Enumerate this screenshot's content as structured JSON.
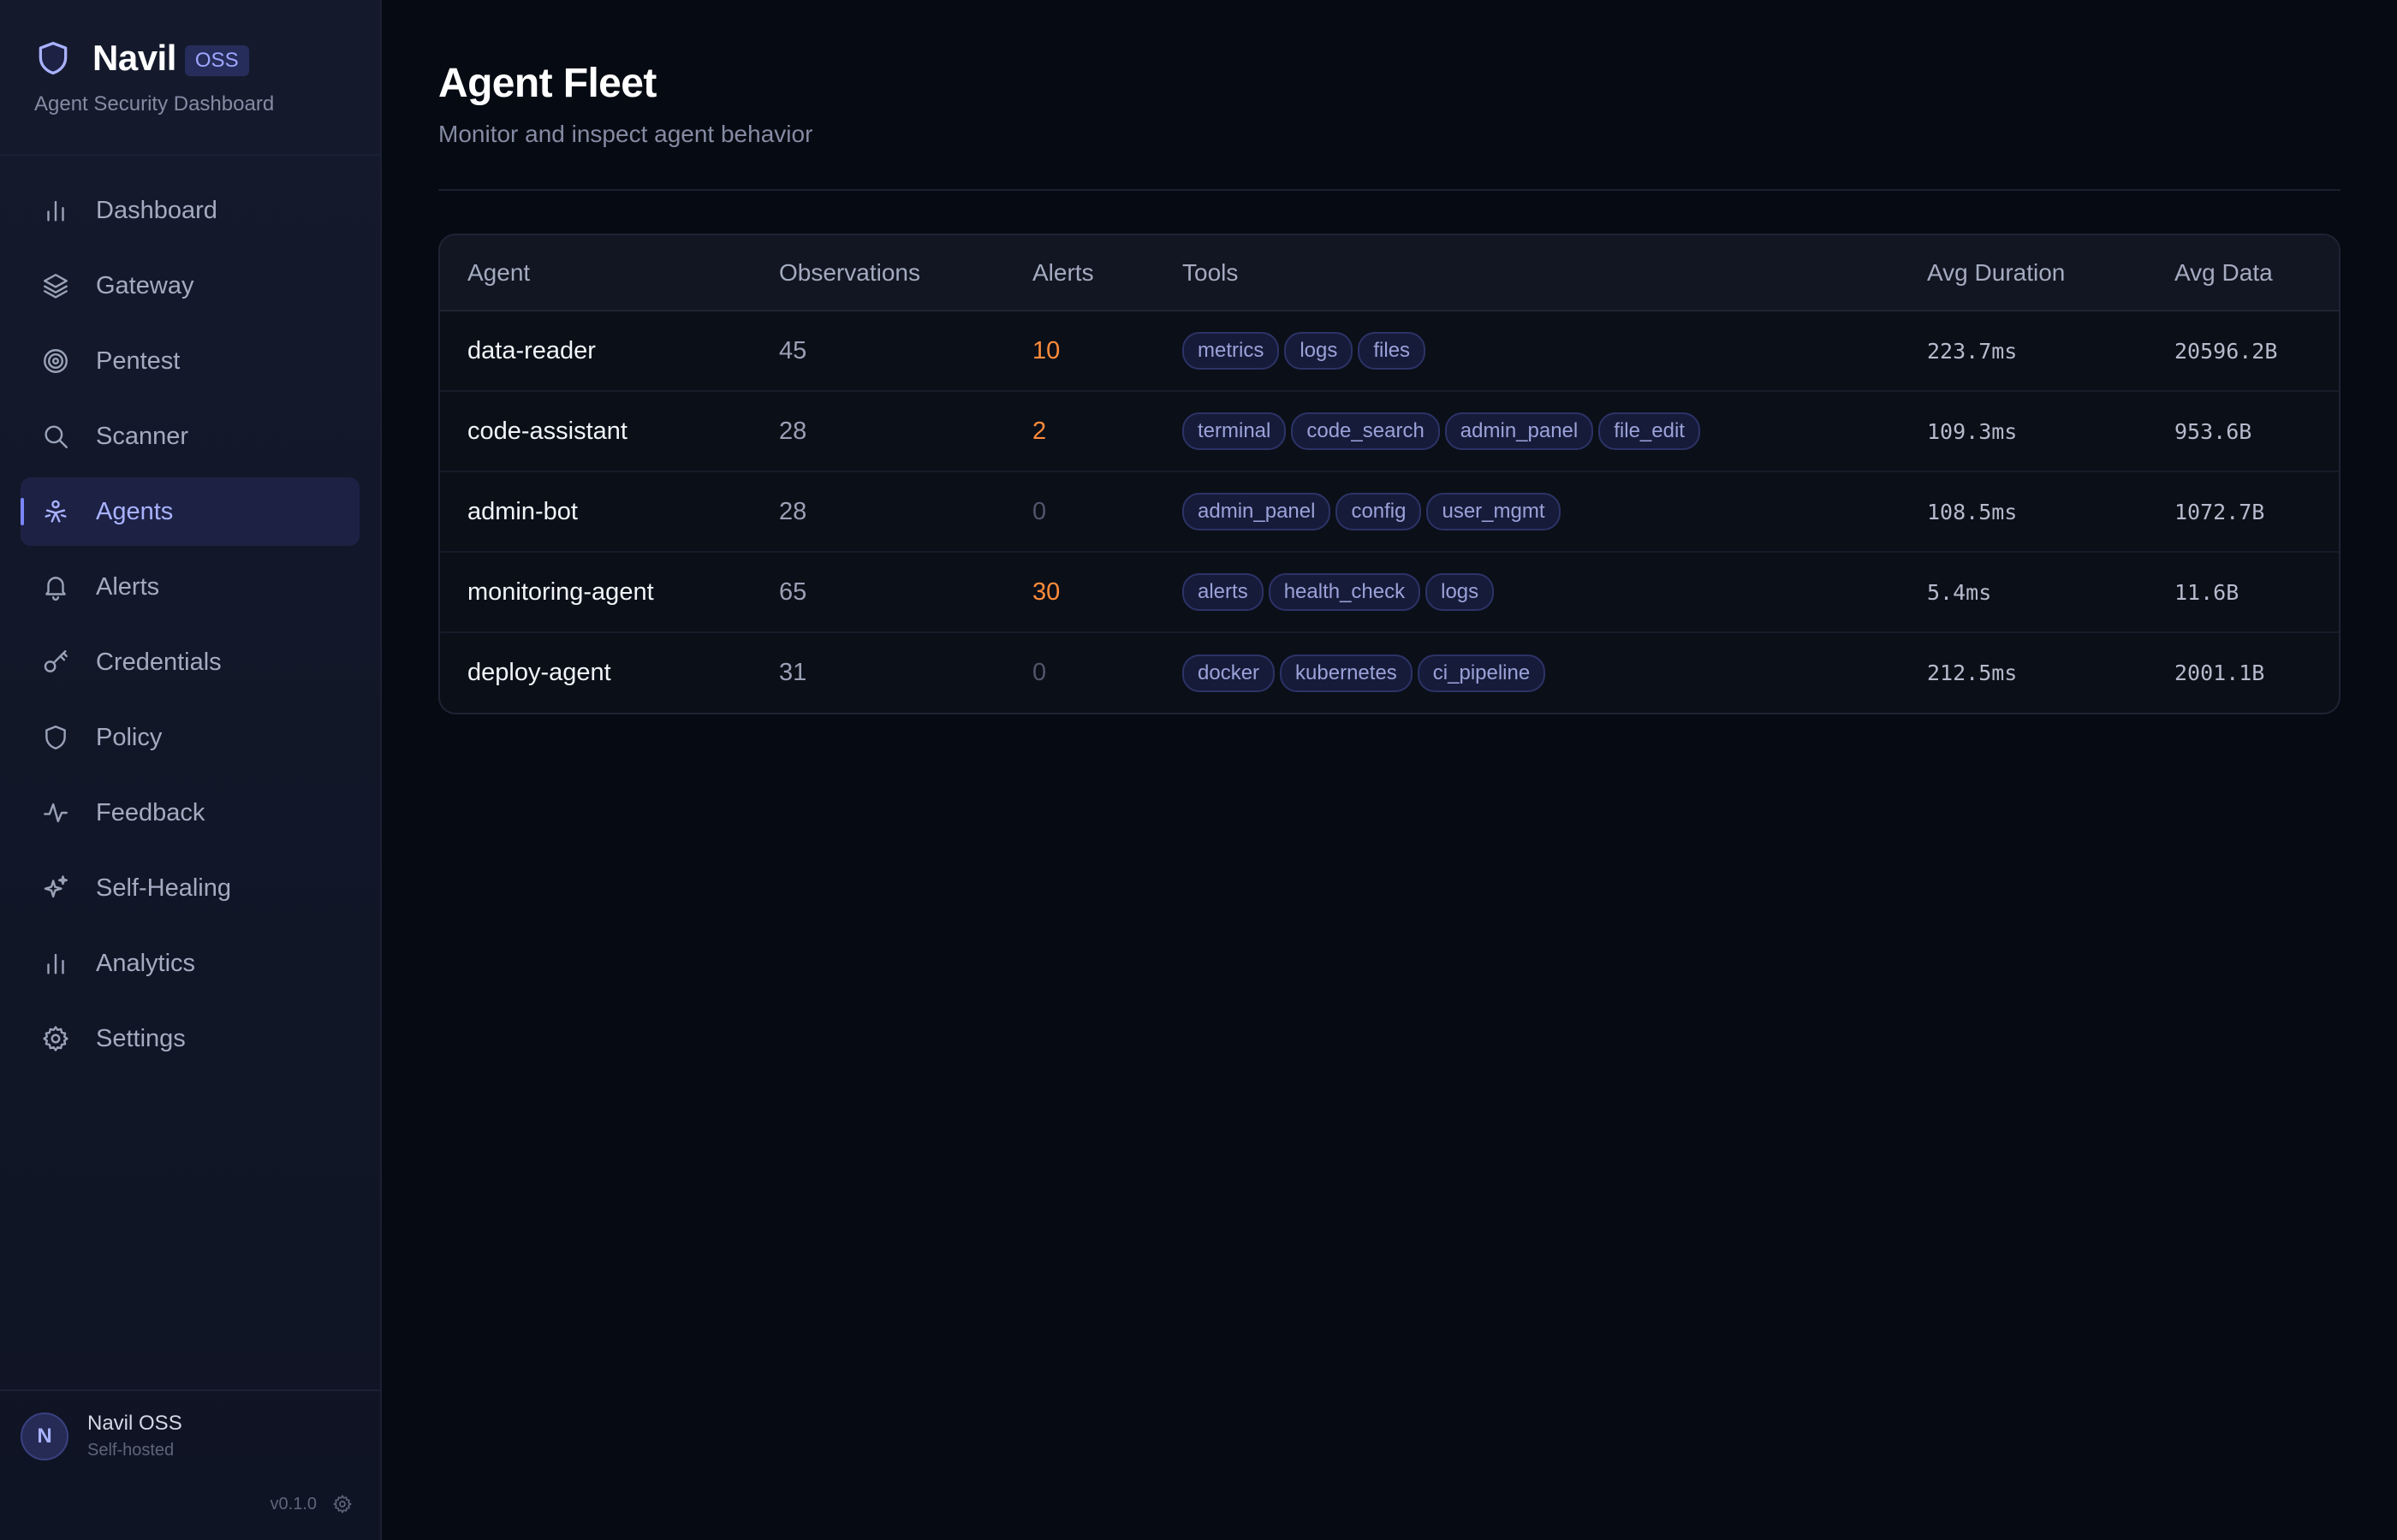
{
  "brand": {
    "name": "Navil",
    "badge": "OSS",
    "subtitle": "Agent Security Dashboard"
  },
  "nav": {
    "items": [
      {
        "label": "Dashboard",
        "icon": "bar-chart-icon"
      },
      {
        "label": "Gateway",
        "icon": "layers-icon"
      },
      {
        "label": "Pentest",
        "icon": "target-icon"
      },
      {
        "label": "Scanner",
        "icon": "search-icon"
      },
      {
        "label": "Agents",
        "icon": "agent-icon",
        "active": true
      },
      {
        "label": "Alerts",
        "icon": "bell-icon"
      },
      {
        "label": "Credentials",
        "icon": "key-icon"
      },
      {
        "label": "Policy",
        "icon": "shield-icon"
      },
      {
        "label": "Feedback",
        "icon": "activity-icon"
      },
      {
        "label": "Self-Healing",
        "icon": "sparkles-icon"
      },
      {
        "label": "Analytics",
        "icon": "bar-chart-icon"
      },
      {
        "label": "Settings",
        "icon": "gear-icon"
      }
    ]
  },
  "footer": {
    "avatar_initial": "N",
    "user_name": "Navil OSS",
    "user_sub": "Self-hosted",
    "version": "v0.1.0"
  },
  "page": {
    "title": "Agent Fleet",
    "subtitle": "Monitor and inspect agent behavior"
  },
  "table": {
    "headers": [
      "Agent",
      "Observations",
      "Alerts",
      "Tools",
      "Avg Duration",
      "Avg Data"
    ],
    "rows": [
      {
        "agent": "data-reader",
        "observations": "45",
        "alerts": "10",
        "tools": [
          "metrics",
          "logs",
          "files"
        ],
        "avg_duration": "223.7ms",
        "avg_data": "20596.2B"
      },
      {
        "agent": "code-assistant",
        "observations": "28",
        "alerts": "2",
        "tools": [
          "terminal",
          "code_search",
          "admin_panel",
          "file_edit"
        ],
        "avg_duration": "109.3ms",
        "avg_data": "953.6B"
      },
      {
        "agent": "admin-bot",
        "observations": "28",
        "alerts": "0",
        "tools": [
          "admin_panel",
          "config",
          "user_mgmt"
        ],
        "avg_duration": "108.5ms",
        "avg_data": "1072.7B"
      },
      {
        "agent": "monitoring-agent",
        "observations": "65",
        "alerts": "30",
        "tools": [
          "alerts",
          "health_check",
          "logs"
        ],
        "avg_duration": "5.4ms",
        "avg_data": "11.6B"
      },
      {
        "agent": "deploy-agent",
        "observations": "31",
        "alerts": "0",
        "tools": [
          "docker",
          "kubernetes",
          "ci_pipeline"
        ],
        "avg_duration": "212.5ms",
        "avg_data": "2001.1B"
      }
    ]
  },
  "colors": {
    "accent": "#7c86ff",
    "alert_high": "#ff8c3b",
    "alert_zero": "#4f566a",
    "background": "#060a12",
    "sidebar": "#141a2c"
  }
}
